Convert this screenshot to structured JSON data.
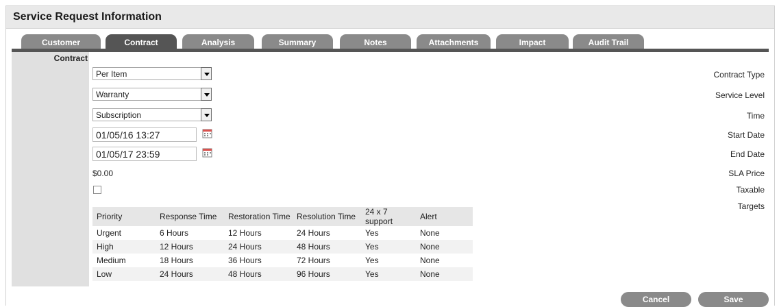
{
  "page_title": "Service Request Information",
  "tabs": [
    {
      "label": "Customer"
    },
    {
      "label": "Contract"
    },
    {
      "label": "Analysis"
    },
    {
      "label": "Summary"
    },
    {
      "label": "Notes"
    },
    {
      "label": "Attachments"
    },
    {
      "label": "Impact"
    },
    {
      "label": "Audit Trail"
    }
  ],
  "active_tab": "Contract",
  "section_title": "Contract",
  "form": {
    "contract_type": {
      "label": "Contract Type",
      "value": "Per Item"
    },
    "service_level": {
      "label": "Service Level",
      "value": "Warranty"
    },
    "time": {
      "label": "Time",
      "value": "Subscription"
    },
    "start_date": {
      "label": "Start Date",
      "value": "01/05/16 13:27"
    },
    "end_date": {
      "label": "End Date",
      "value": "01/05/17 23:59"
    },
    "sla_price": {
      "label": "SLA Price",
      "value": "$0.00"
    },
    "taxable": {
      "label": "Taxable",
      "checked": false
    },
    "targets_label": "Targets"
  },
  "targets": {
    "headers": [
      "Priority",
      "Response Time",
      "Restoration Time",
      "Resolution Time",
      "24 x 7 support",
      "Alert"
    ],
    "rows": [
      [
        "Urgent",
        "6 Hours",
        "12 Hours",
        "24 Hours",
        "Yes",
        "None"
      ],
      [
        "High",
        "12 Hours",
        "24 Hours",
        "48 Hours",
        "Yes",
        "None"
      ],
      [
        "Medium",
        "18 Hours",
        "36 Hours",
        "72 Hours",
        "Yes",
        "None"
      ],
      [
        "Low",
        "24 Hours",
        "48 Hours",
        "96 Hours",
        "Yes",
        "None"
      ]
    ]
  },
  "buttons": {
    "cancel": "Cancel",
    "save": "Save"
  },
  "icons": {
    "calendar": "calendar-icon",
    "dropdown": "chevron-down-icon"
  },
  "colors": {
    "tab_inactive": "#8a8a8a",
    "tab_active": "#555555",
    "button": "#8a8a8a"
  }
}
